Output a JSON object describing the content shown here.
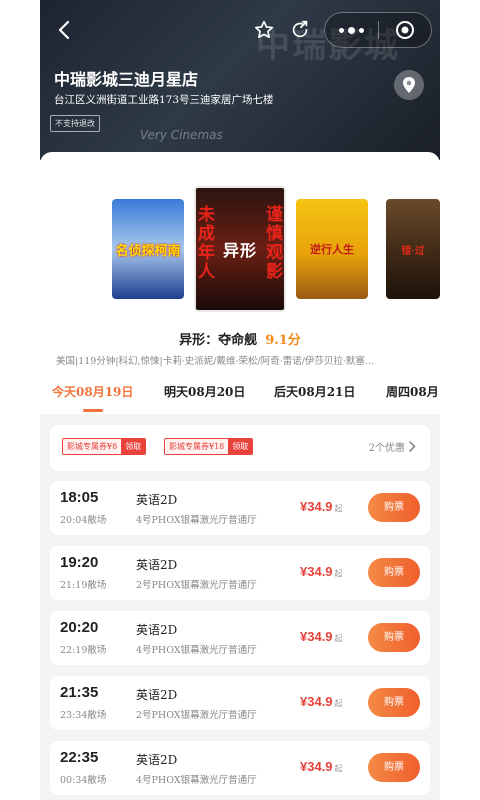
{
  "cinema": {
    "name": "中瑞影城三迪月星店",
    "address": "台江区义洲街道工业路173号三迪家居广场七楼",
    "refund_tag": "不支持退改",
    "bg_sign": "中瑞影城",
    "bg_sign2": "Very Cinemas"
  },
  "posters": [
    {
      "title": "名侦探柯南"
    },
    {
      "title": "异形",
      "side_left": "未成年人",
      "side_right": "谨慎观影"
    },
    {
      "title": "逆行人生"
    },
    {
      "title": "错·过"
    }
  ],
  "movie": {
    "name": "异形：夺命舰",
    "score": "9.1分",
    "meta": "美国|119分钟|科幻,惊悚|卡莉·史派妮/戴维·荣松/阿奇·雷诺/伊莎贝拉·默塞..."
  },
  "dates": [
    {
      "label": "今天08月19日"
    },
    {
      "label": "明天08月20日"
    },
    {
      "label": "后天08月21日"
    },
    {
      "label": "周四08月"
    }
  ],
  "coupons": [
    {
      "text": "影城专属券¥8",
      "action": "领取"
    },
    {
      "text": "影城专属券¥18",
      "action": "领取"
    }
  ],
  "offer_count": "2个优惠",
  "showtimes": [
    {
      "start": "18:05",
      "end": "20:04散场",
      "lang": "英语2D",
      "hall": "4号PHOX银幕激光厅普通厅",
      "price": "¥34.9",
      "suffix": "起",
      "buy": "购票"
    },
    {
      "start": "19:20",
      "end": "21:19散场",
      "lang": "英语2D",
      "hall": "2号PHOX银幕激光厅普通厅",
      "price": "¥34.9",
      "suffix": "起",
      "buy": "购票"
    },
    {
      "start": "20:20",
      "end": "22:19散场",
      "lang": "英语2D",
      "hall": "4号PHOX银幕激光厅普通厅",
      "price": "¥34.9",
      "suffix": "起",
      "buy": "购票"
    },
    {
      "start": "21:35",
      "end": "23:34散场",
      "lang": "英语2D",
      "hall": "2号PHOX银幕激光厅普通厅",
      "price": "¥34.9",
      "suffix": "起",
      "buy": "购票"
    },
    {
      "start": "22:35",
      "end": "00:34散场",
      "lang": "英语2D",
      "hall": "4号PHOX银幕激光厅普通厅",
      "price": "¥34.9",
      "suffix": "起",
      "buy": "购票"
    }
  ],
  "colors": {
    "accent": "#f2733a",
    "price": "#e8423a",
    "score": "#f08a1b"
  },
  "icons": {
    "back": "chevron-left-icon",
    "favorite": "star-icon",
    "share": "share-icon",
    "more": "more-dots-icon",
    "close": "target-icon",
    "location": "location-pin-icon",
    "offer_arrow": "chevron-right-icon"
  }
}
